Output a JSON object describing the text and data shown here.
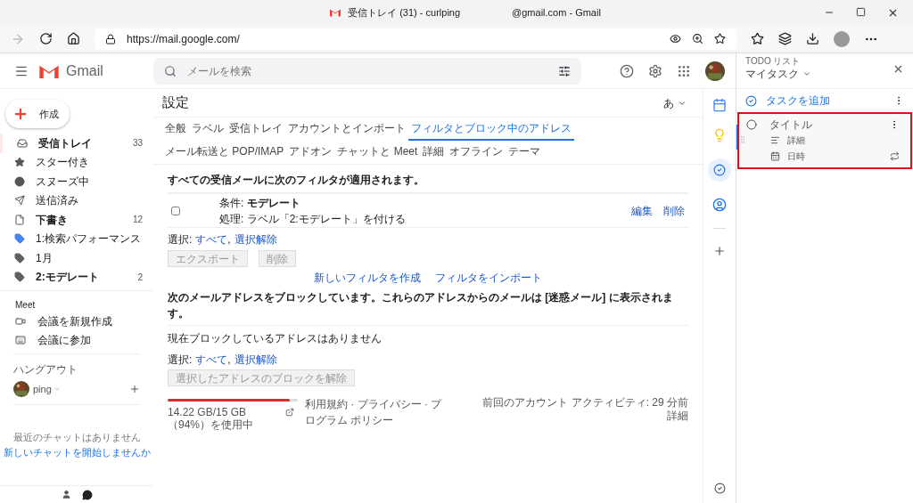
{
  "window": {
    "title_parts": [
      "受信トレイ (31) - curlping",
      "@gmail.com - Gmail"
    ]
  },
  "browser": {
    "url": "https://mail.google.com/"
  },
  "header": {
    "app_name": "Gmail",
    "search": {
      "placeholder": "メールを検索"
    }
  },
  "sidebar": {
    "compose": "作成",
    "items": [
      {
        "label": "受信トレイ",
        "count": "33",
        "bold": true,
        "selected": true
      },
      {
        "label": "スター付き",
        "bold": false,
        "selected": false
      },
      {
        "label": "スヌーズ中",
        "bold": false,
        "selected": false
      },
      {
        "label": "送信済み",
        "bold": false,
        "selected": false
      },
      {
        "label": "下書き",
        "count": "12",
        "bold": true,
        "selected": false
      },
      {
        "label": "1:検索パフォーマンス",
        "color": "#4285f4",
        "bold": false,
        "selected": false
      },
      {
        "label": "1月",
        "color": "#616161",
        "bold": false,
        "selected": false
      },
      {
        "label": "2:モデレート",
        "count": "2",
        "color": "#616161",
        "bold": true,
        "selected": false
      }
    ],
    "meet": {
      "title": "Meet",
      "items": [
        {
          "label": "会議を新規作成"
        },
        {
          "label": "会議に参加"
        }
      ]
    },
    "hangouts": {
      "title": "ハングアウト",
      "user": "ping",
      "empty": "最近のチャットはありません",
      "link": "新しいチャットを開始しませんか"
    }
  },
  "settings": {
    "title": "設定",
    "input_tool": "あ",
    "tabs": [
      {
        "label": "全般",
        "selected": false
      },
      {
        "label": "ラベル",
        "selected": false
      },
      {
        "label": "受信トレイ",
        "selected": false
      },
      {
        "label": "アカウントとインポート",
        "selected": false
      },
      {
        "label": "フィルタとブロック中のアドレス",
        "selected": true
      },
      {
        "label": "メール転送と POP/IMAP",
        "selected": false
      },
      {
        "label": "アドオン",
        "selected": false
      },
      {
        "label": "チャットと Meet",
        "selected": false
      },
      {
        "label": "詳細",
        "selected": false
      },
      {
        "label": "オフライン",
        "selected": false
      },
      {
        "label": "テーマ",
        "selected": false
      }
    ],
    "filters_heading": "すべての受信メールに次のフィルタが適用されます。",
    "filters": [
      {
        "condition": "条件: **モデレート**",
        "action": "処理: ラベル「2:モデレート」を付ける",
        "checked": false,
        "edit": "編集",
        "delete": "削除"
      }
    ],
    "select_label": "選択:",
    "select_all": "すべて",
    "select_separator": ",",
    "select_none": "選択解除",
    "filter_buttons": [
      "エクスポート",
      "削除"
    ],
    "filter_links": [
      "新しいフィルタを作成",
      "フィルタをインポート"
    ],
    "blocked_heading": "次のメールアドレスをブロックしています。これらのアドレスからのメールは [迷惑メール] に表示されます。",
    "blocked_empty": "現在ブロックしているアドレスはありません",
    "blocked_select_label": "選択:",
    "blocked_select_all": "すべて",
    "blocked_select_separator": ",",
    "blocked_select_none": "選択解除",
    "unblock_button": "選択したアドレスのブロックを解除"
  },
  "footer": {
    "storage": {
      "level": 0.94,
      "text": "14.22 GB/15 GB（94%）を使用中"
    },
    "policy": "利用規約 · プライバシー · プログラム ポリシー",
    "activity": "前回のアカウント アクティビティ: 29 分前",
    "details": "詳細"
  },
  "tasks": {
    "caption": "TODO リスト",
    "list_name": "マイタスク",
    "add": "タスクを追加",
    "items": [
      {
        "title": "タイトル",
        "details": "詳細",
        "date": "日時",
        "highlighted": true
      }
    ]
  }
}
